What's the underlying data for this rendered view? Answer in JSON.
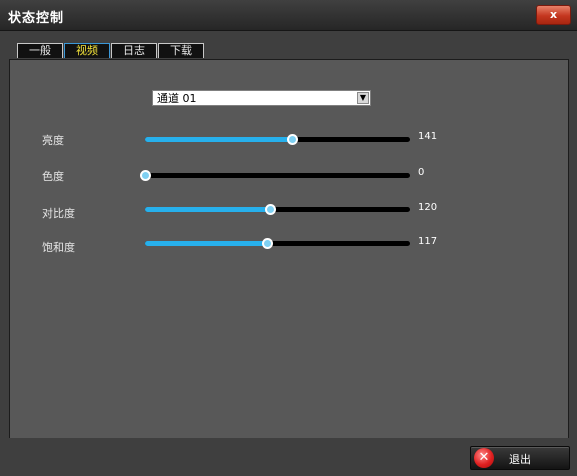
{
  "window": {
    "title": "状态控制",
    "close_label": "x"
  },
  "tabs": [
    {
      "label": "一般"
    },
    {
      "label": "视频",
      "active": true
    },
    {
      "label": "日志"
    },
    {
      "label": "下载"
    }
  ],
  "channel_select": {
    "value": "通道 01"
  },
  "sliders": [
    {
      "label": "亮度",
      "value": "141",
      "level": 0.553
    },
    {
      "label": "色度",
      "value": "0",
      "level": 0.0
    },
    {
      "label": "对比度",
      "value": "120",
      "level": 0.47
    },
    {
      "label": "饱和度",
      "value": "117",
      "level": 0.459
    }
  ],
  "footer": {
    "exit_label": "退出"
  },
  "colors": {
    "accent": "#27b0ec",
    "active_tab_text": "#f2e23a",
    "panel": "#585858",
    "titlebar": "#2a2a2a"
  }
}
